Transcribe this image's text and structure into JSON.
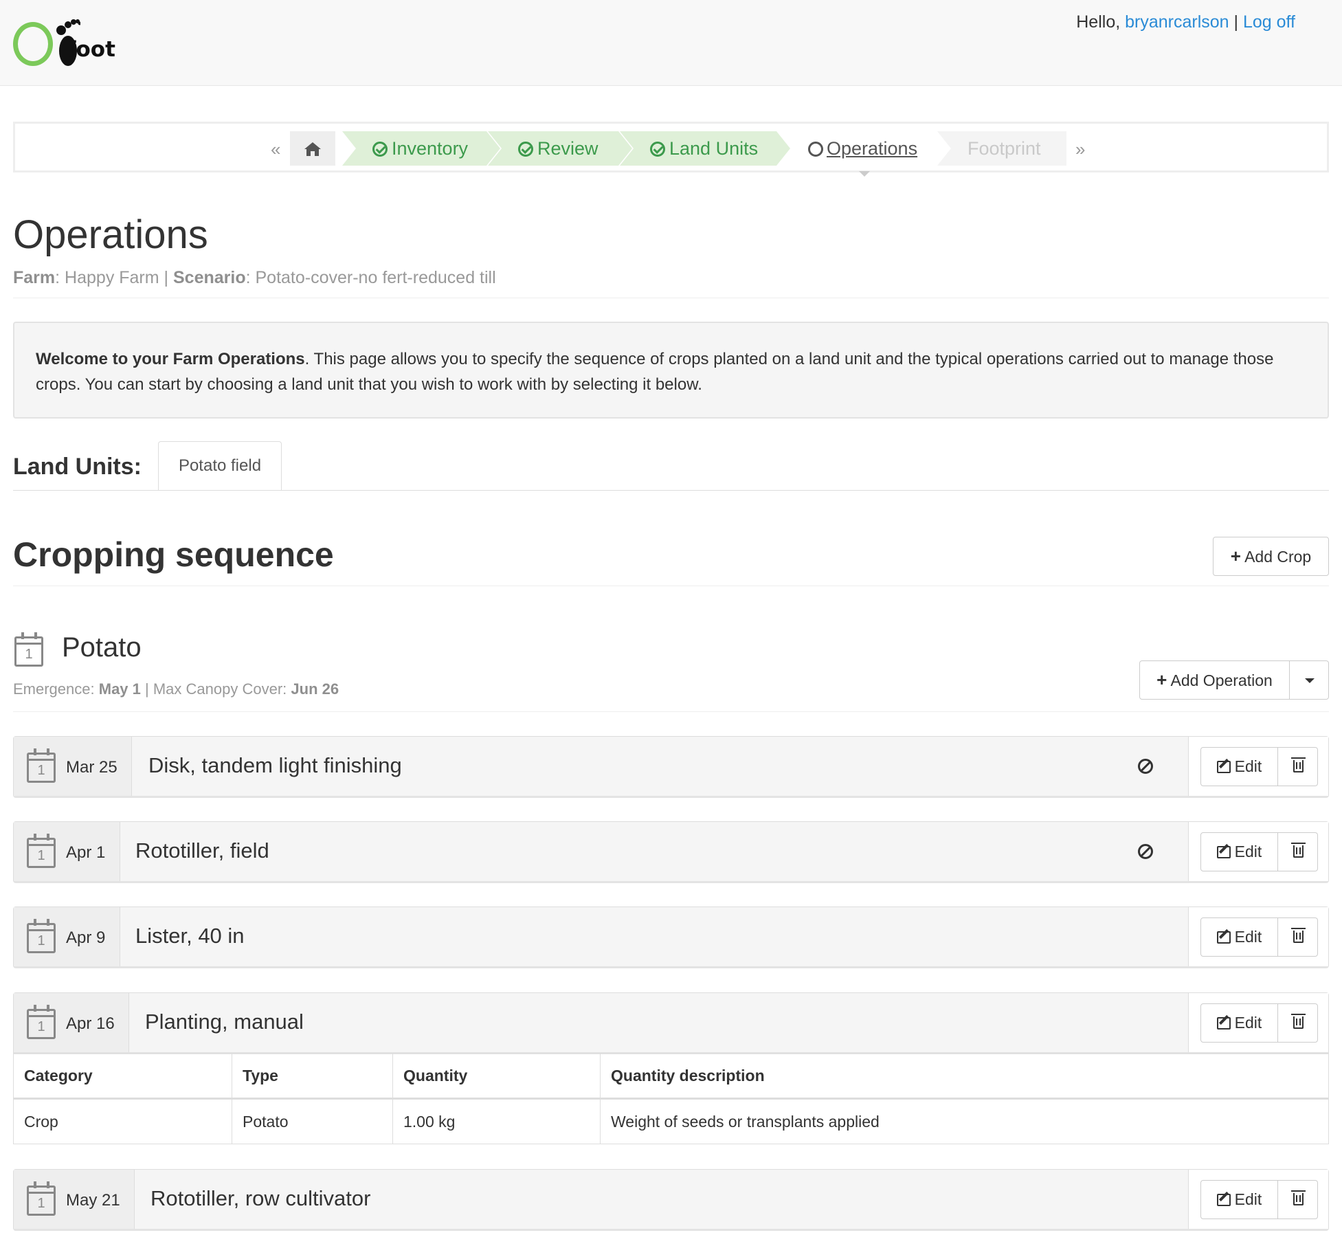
{
  "header": {
    "logo_text": "foot",
    "greeting": "Hello,",
    "username": "bryanrcarlson",
    "separator": "|",
    "logoff": "Log off"
  },
  "wizard": {
    "prev": "«",
    "next": "»",
    "steps": [
      {
        "label": "Inventory",
        "state": "done"
      },
      {
        "label": "Review",
        "state": "done"
      },
      {
        "label": "Land Units",
        "state": "done"
      },
      {
        "label": "Operations",
        "state": "current"
      },
      {
        "label": "Footprint",
        "state": "disabled"
      }
    ]
  },
  "page": {
    "title": "Operations",
    "farm_label": "Farm",
    "farm_name": "Happy Farm",
    "scenario_label": "Scenario",
    "scenario_name": "Potato-cover-no fert-reduced till"
  },
  "welcome": {
    "bold": "Welcome to your Farm Operations",
    "text": ". This page allows you to specify the sequence of crops planted on a land unit and the typical operations carried out to manage those crops. You can start by choosing a land unit that you wish to work with by selecting it below."
  },
  "land_units": {
    "label": "Land Units:",
    "tabs": [
      "Potato field"
    ]
  },
  "cropping": {
    "title": "Cropping sequence",
    "add_crop": "Add Crop"
  },
  "crop": {
    "name": "Potato",
    "emergence_label": "Emergence:",
    "emergence": "May 1",
    "canopy_label": "Max Canopy Cover:",
    "canopy": "Jun 26",
    "add_operation": "Add Operation"
  },
  "operations": [
    {
      "date": "Mar 25",
      "name": "Disk, tandem light finishing",
      "no_irrigation": true
    },
    {
      "date": "Apr 1",
      "name": "Rototiller, field",
      "no_irrigation": true
    },
    {
      "date": "Apr 9",
      "name": "Lister, 40 in",
      "no_irrigation": false
    },
    {
      "date": "Apr 16",
      "name": "Planting, manual",
      "no_irrigation": false
    },
    {
      "date": "May 21",
      "name": "Rototiller, row cultivator",
      "no_irrigation": false
    }
  ],
  "op_buttons": {
    "edit": "Edit"
  },
  "planting_table": {
    "headers": [
      "Category",
      "Type",
      "Quantity",
      "Quantity description"
    ],
    "rows": [
      [
        "Crop",
        "Potato",
        "1.00 kg",
        "Weight of seeds or transplants applied"
      ]
    ]
  },
  "colors": {
    "accent": "#2a8bd6",
    "done_bg": "#dff0d8",
    "done_text": "#3c9a4c",
    "logo_green": "#7cc95a"
  }
}
